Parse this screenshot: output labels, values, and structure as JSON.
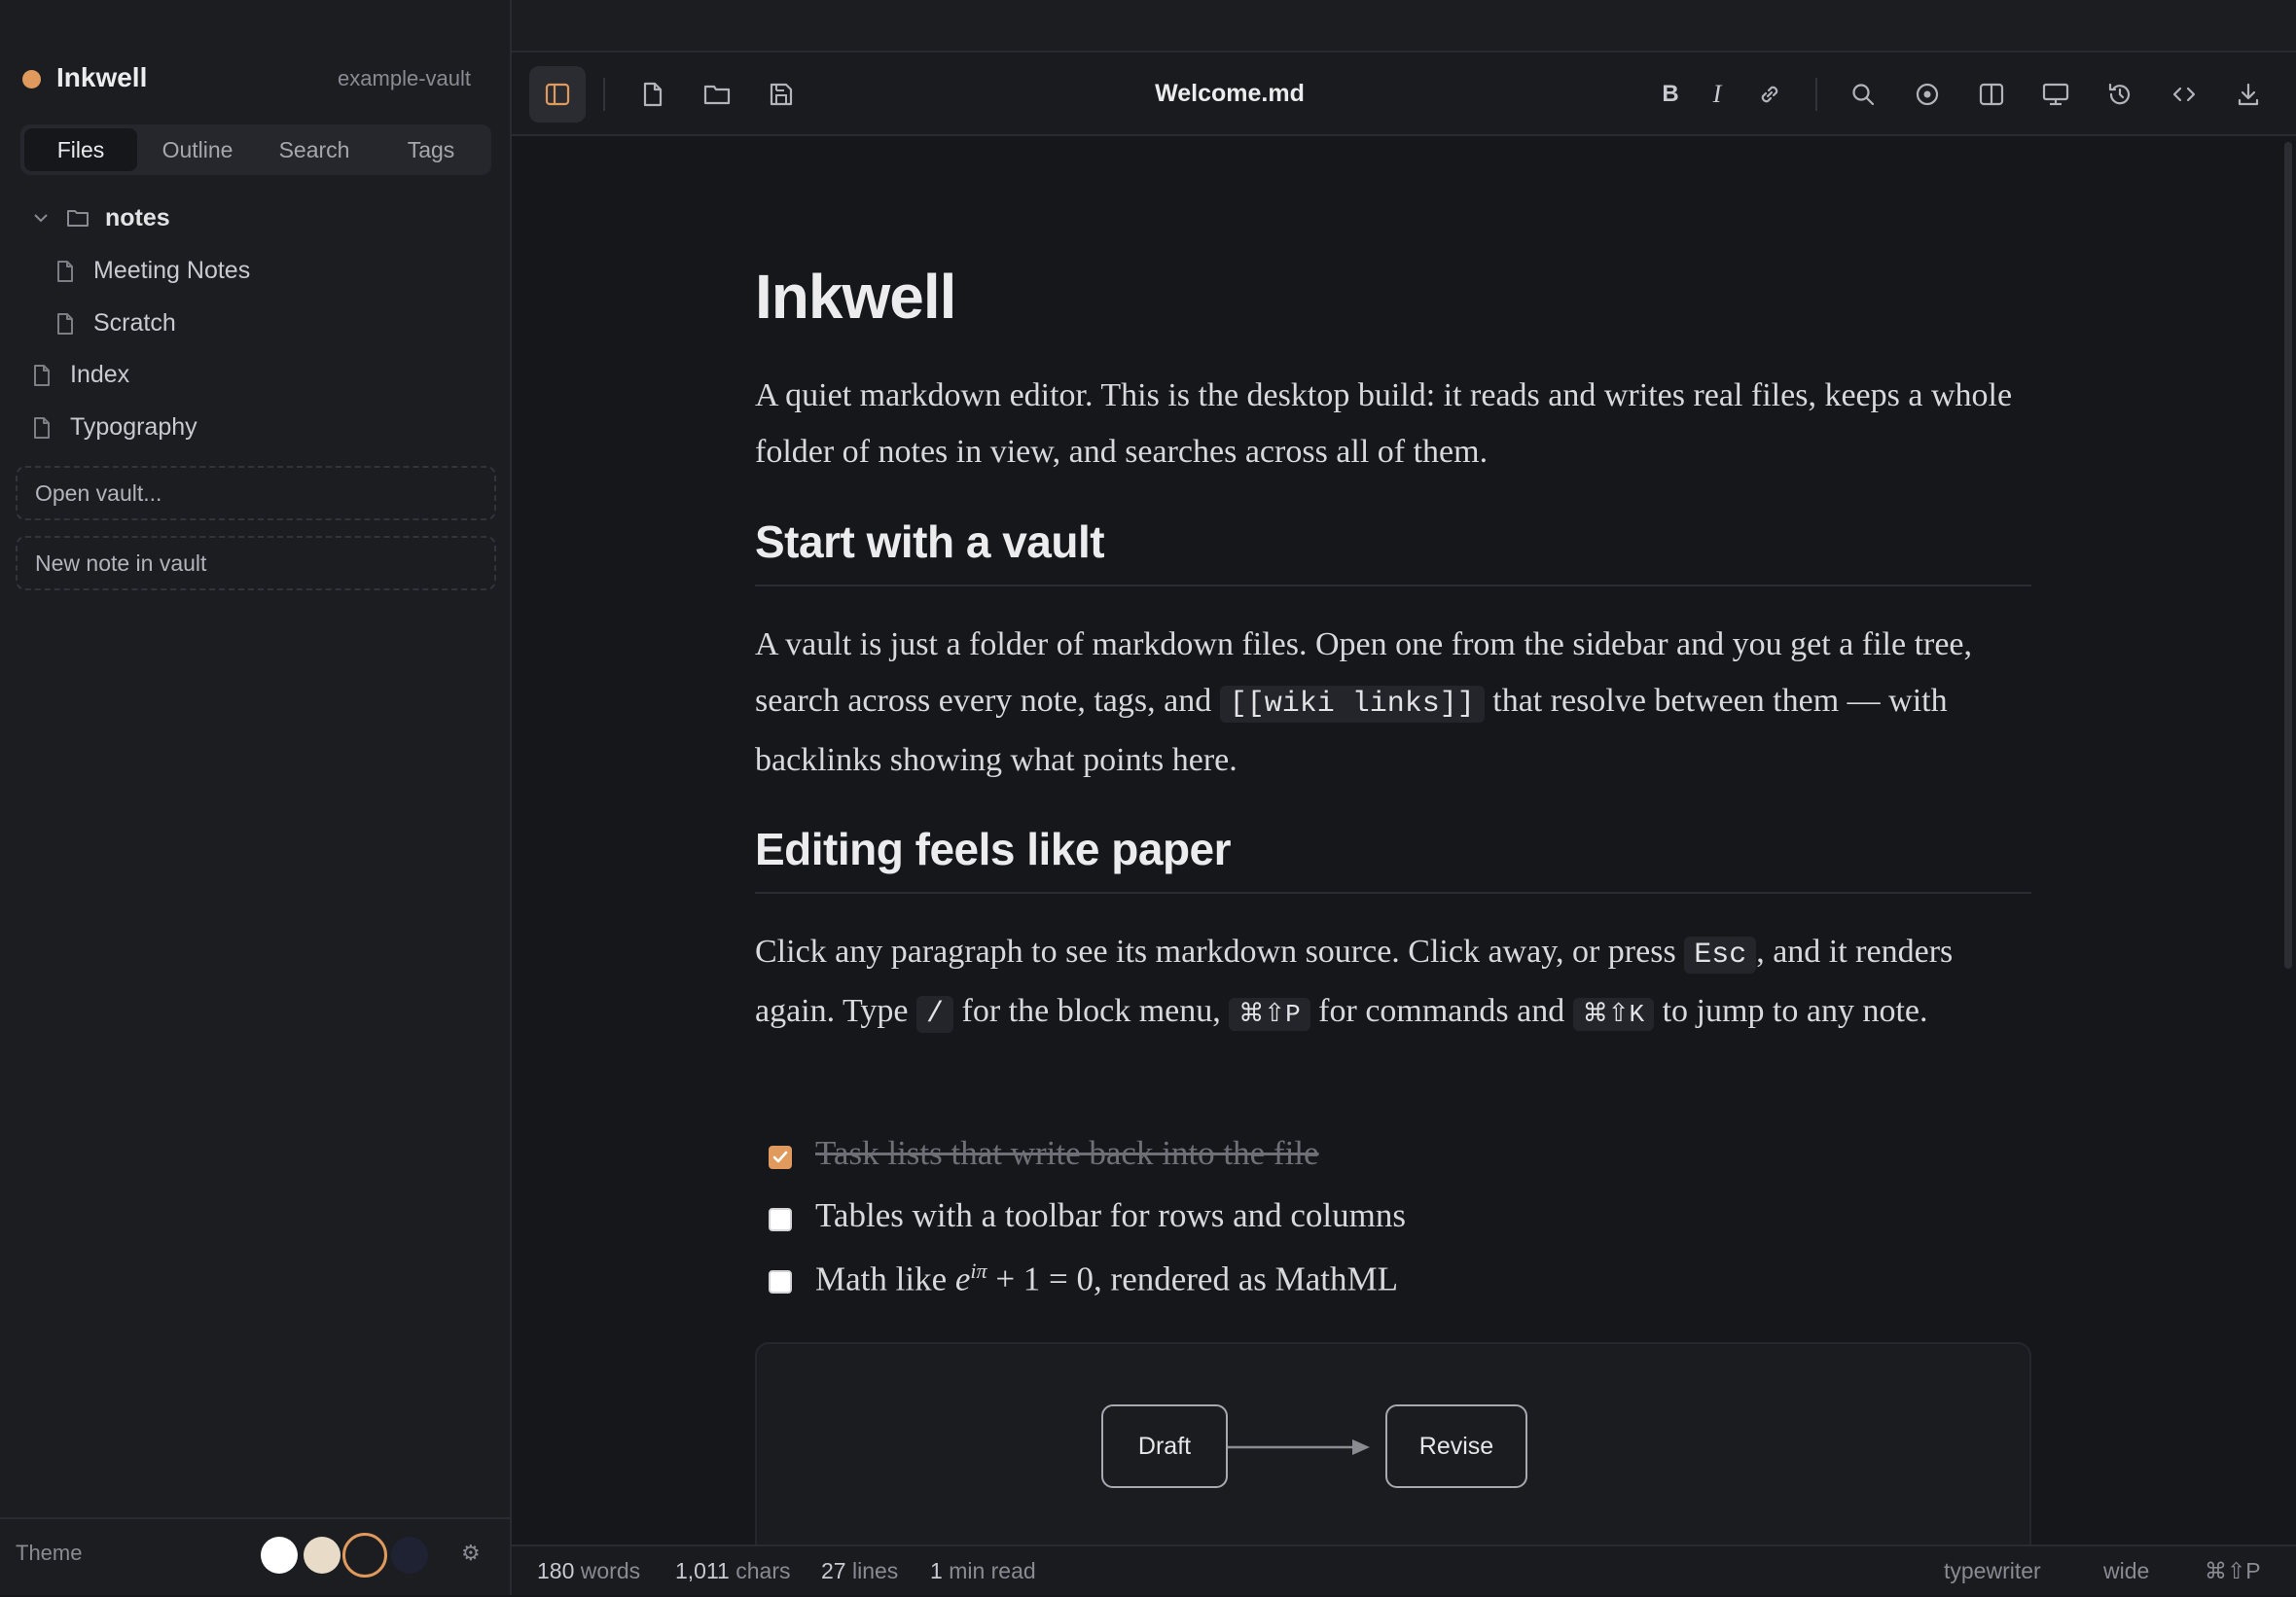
{
  "app": {
    "name": "Inkwell",
    "vault": "example-vault",
    "accent": "#e09a5e"
  },
  "sidebar": {
    "tabs": [
      "Files",
      "Outline",
      "Search",
      "Tags"
    ],
    "active_tab": "Files",
    "tree": {
      "folder": "notes",
      "folder_children": [
        "Meeting Notes",
        "Scratch"
      ],
      "root_files": [
        "Index",
        "Typography"
      ]
    },
    "actions": [
      "Open vault...",
      "New note in vault"
    ],
    "theme_label": "Theme",
    "themes": [
      "#ffffff",
      "#e8dcc8",
      "#1c1d21",
      "#1e2233"
    ],
    "active_theme_index": 2
  },
  "toolbar": {
    "title": "Welcome.md",
    "bold": "B",
    "italic": "I",
    "icons_left": [
      "sidebar-toggle-icon",
      "new-file-icon",
      "folder-icon",
      "save-icon"
    ],
    "icons_right": [
      "link-icon",
      "search-icon",
      "focus-icon",
      "split-view-icon",
      "present-icon",
      "history-icon",
      "source-code-icon",
      "download-icon"
    ]
  },
  "doc": {
    "h1": "Inkwell",
    "intro": "A quiet markdown editor. This is the desktop build: it reads and writes real files, keeps a whole folder of notes in view, and searches across all of them.",
    "h2_vault": "Start with a vault",
    "vault_p1": "A vault is just a folder of markdown files. Open one from the sidebar and you get a file tree, search across every note, tags, and",
    "vault_code": "[[wiki links]]",
    "vault_p2": "that resolve between them — with backlinks showing what points here.",
    "h2_paper": "Editing feels like paper",
    "paper_p1": "Click any paragraph to see its markdown source. Click away, or press",
    "paper_code1": "Esc",
    "paper_p2": ", and it renders again. Type",
    "paper_code2": "/",
    "paper_p3": "for the block menu,",
    "paper_code3": "⌘⇧P",
    "paper_p4": "for commands and",
    "paper_code4": "⌘⇧K",
    "paper_p5": "to jump to any note.",
    "tasks": [
      {
        "text": "Task lists that write back into the file",
        "checked": true
      },
      {
        "text": "Tables with a toolbar for rows and columns",
        "checked": false
      },
      {
        "text_before": "Math like ",
        "math_base": "e",
        "math_sup": "iπ",
        "text_after": " + 1 = 0, rendered as MathML",
        "checked": false
      }
    ],
    "diagram_nodes": [
      "Draft",
      "Revise"
    ]
  },
  "status": {
    "words_num": "180",
    "words_label": "words",
    "chars_num": "1,011",
    "chars_label": "chars",
    "lines_num": "27",
    "lines_label": "lines",
    "read_num": "1",
    "read_label": "min read",
    "mode1": "typewriter",
    "mode2": "wide",
    "shortcut": "⌘⇧P"
  }
}
